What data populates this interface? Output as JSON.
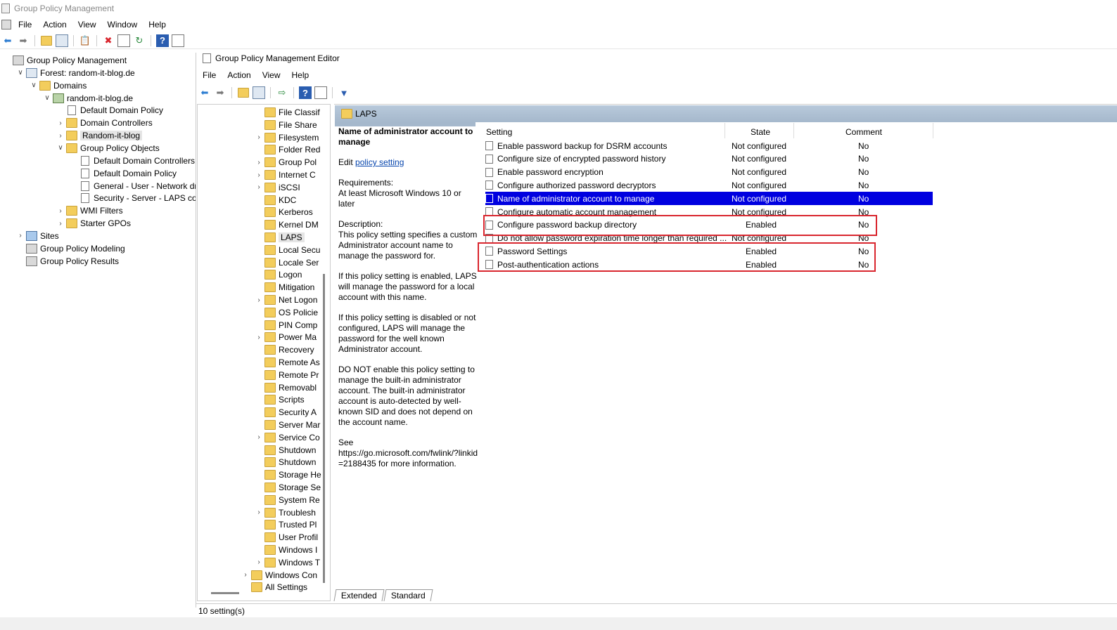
{
  "app_title": "Group Policy Management",
  "outer_menu": [
    "File",
    "Action",
    "View",
    "Window",
    "Help"
  ],
  "left_tree": [
    {
      "label": "Group Policy Management",
      "indent": 0,
      "twisty": "",
      "icon": "gpm"
    },
    {
      "label": "Forest: random-it-blog.de",
      "indent": 1,
      "twisty": "v",
      "icon": "forest"
    },
    {
      "label": "Domains",
      "indent": 2,
      "twisty": "v",
      "icon": "folder"
    },
    {
      "label": "random-it-blog.de",
      "indent": 3,
      "twisty": "v",
      "icon": "domain"
    },
    {
      "label": "Default Domain Policy",
      "indent": 4,
      "twisty": "",
      "icon": "doc"
    },
    {
      "label": "Domain Controllers",
      "indent": 4,
      "twisty": ">",
      "icon": "folder"
    },
    {
      "label": "Random-it-blog",
      "indent": 4,
      "twisty": ">",
      "icon": "folder",
      "selected": true
    },
    {
      "label": "Group Policy Objects",
      "indent": 4,
      "twisty": "v",
      "icon": "folder"
    },
    {
      "label": "Default Domain Controllers Pol",
      "indent": 5,
      "twisty": "",
      "icon": "doc"
    },
    {
      "label": "Default Domain Policy",
      "indent": 5,
      "twisty": "",
      "icon": "doc"
    },
    {
      "label": "General - User - Network drive m",
      "indent": 5,
      "twisty": "",
      "icon": "doc"
    },
    {
      "label": "Security - Server - LAPS configu",
      "indent": 5,
      "twisty": "",
      "icon": "doc"
    },
    {
      "label": "WMI Filters",
      "indent": 4,
      "twisty": ">",
      "icon": "folder"
    },
    {
      "label": "Starter GPOs",
      "indent": 4,
      "twisty": ">",
      "icon": "folder"
    },
    {
      "label": "Sites",
      "indent": 1,
      "twisty": ">",
      "icon": "sites"
    },
    {
      "label": "Group Policy Modeling",
      "indent": 1,
      "twisty": "",
      "icon": "gpm"
    },
    {
      "label": "Group Policy Results",
      "indent": 1,
      "twisty": "",
      "icon": "gpm"
    }
  ],
  "editor": {
    "title": "Group Policy Management Editor",
    "menu": [
      "File",
      "Action",
      "View",
      "Help"
    ],
    "tree": [
      {
        "label": "File Classif",
        "twisty": ""
      },
      {
        "label": "File Share",
        "twisty": ""
      },
      {
        "label": "Filesystem",
        "twisty": ">"
      },
      {
        "label": "Folder Red",
        "twisty": ""
      },
      {
        "label": "Group Pol",
        "twisty": ">"
      },
      {
        "label": "Internet C",
        "twisty": ">"
      },
      {
        "label": "iSCSI",
        "twisty": ">"
      },
      {
        "label": "KDC",
        "twisty": ""
      },
      {
        "label": "Kerberos",
        "twisty": ""
      },
      {
        "label": "Kernel DM",
        "twisty": ""
      },
      {
        "label": "LAPS",
        "twisty": "",
        "selected": true
      },
      {
        "label": "Local Secu",
        "twisty": ""
      },
      {
        "label": "Locale Ser",
        "twisty": ""
      },
      {
        "label": "Logon",
        "twisty": ""
      },
      {
        "label": "Mitigation",
        "twisty": ""
      },
      {
        "label": "Net Logon",
        "twisty": ">"
      },
      {
        "label": "OS Policie",
        "twisty": ""
      },
      {
        "label": "PIN Comp",
        "twisty": ""
      },
      {
        "label": "Power Ma",
        "twisty": ">"
      },
      {
        "label": "Recovery",
        "twisty": ""
      },
      {
        "label": "Remote As",
        "twisty": ""
      },
      {
        "label": "Remote Pr",
        "twisty": ""
      },
      {
        "label": "Removabl",
        "twisty": ""
      },
      {
        "label": "Scripts",
        "twisty": ""
      },
      {
        "label": "Security A",
        "twisty": ""
      },
      {
        "label": "Server Mar",
        "twisty": ""
      },
      {
        "label": "Service Co",
        "twisty": ">"
      },
      {
        "label": "Shutdown",
        "twisty": ""
      },
      {
        "label": "Shutdown",
        "twisty": ""
      },
      {
        "label": "Storage He",
        "twisty": ""
      },
      {
        "label": "Storage Se",
        "twisty": ""
      },
      {
        "label": "System Re",
        "twisty": ""
      },
      {
        "label": "Troublesh",
        "twisty": ">"
      },
      {
        "label": "Trusted Pl",
        "twisty": ""
      },
      {
        "label": "User Profil",
        "twisty": ""
      },
      {
        "label": "Windows I",
        "twisty": ""
      },
      {
        "label": "Windows T",
        "twisty": ">"
      },
      {
        "label": "Windows Con",
        "twisty": ">",
        "outdent": true
      },
      {
        "label": "All Settings",
        "twisty": "",
        "outdent": true
      }
    ],
    "folder_title": "LAPS",
    "description": {
      "title": "Name of administrator account to manage",
      "edit_prefix": "Edit",
      "edit_link": "policy setting",
      "requirements_label": "Requirements:",
      "requirements": "At least Microsoft Windows 10 or later",
      "description_label": "Description:",
      "p1": "This policy setting specifies a custom Administrator account name to manage the password for.",
      "p2": "If this policy setting is enabled, LAPS will manage the password for a local account with this name.",
      "p3": "If this policy setting is disabled or not configured, LAPS will manage the password for the well known Administrator account.",
      "p4": "DO NOT enable this policy setting to manage the built-in administrator account. The built-in administrator account is auto-detected by well-known SID and does not depend on the account name.",
      "see_label": "See",
      "see_text": "https://go.microsoft.com/fwlink/?linkid=2188435 for more information."
    },
    "columns": {
      "setting": "Setting",
      "state": "State",
      "comment": "Comment"
    },
    "settings": [
      {
        "name": "Enable password backup for DSRM accounts",
        "state": "Not configured",
        "comment": "No"
      },
      {
        "name": "Configure size of encrypted password history",
        "state": "Not configured",
        "comment": "No"
      },
      {
        "name": "Enable password encryption",
        "state": "Not configured",
        "comment": "No"
      },
      {
        "name": "Configure authorized password decryptors",
        "state": "Not configured",
        "comment": "No"
      },
      {
        "name": "Name of administrator account to manage",
        "state": "Not configured",
        "comment": "No",
        "selected": true
      },
      {
        "name": "Configure automatic account management",
        "state": "Not configured",
        "comment": "No"
      },
      {
        "name": "Configure password backup directory",
        "state": "Enabled",
        "comment": "No"
      },
      {
        "name": "Do not allow password expiration time longer than required ...",
        "state": "Not configured",
        "comment": "No"
      },
      {
        "name": "Password Settings",
        "state": "Enabled",
        "comment": "No"
      },
      {
        "name": "Post-authentication actions",
        "state": "Enabled",
        "comment": "No"
      }
    ],
    "tabs": [
      "Extended",
      "Standard"
    ],
    "status": "10 setting(s)"
  },
  "colors": {
    "selection": "#0000e0",
    "annotation_box": "#d9262e",
    "header": "#a5b8cc"
  }
}
